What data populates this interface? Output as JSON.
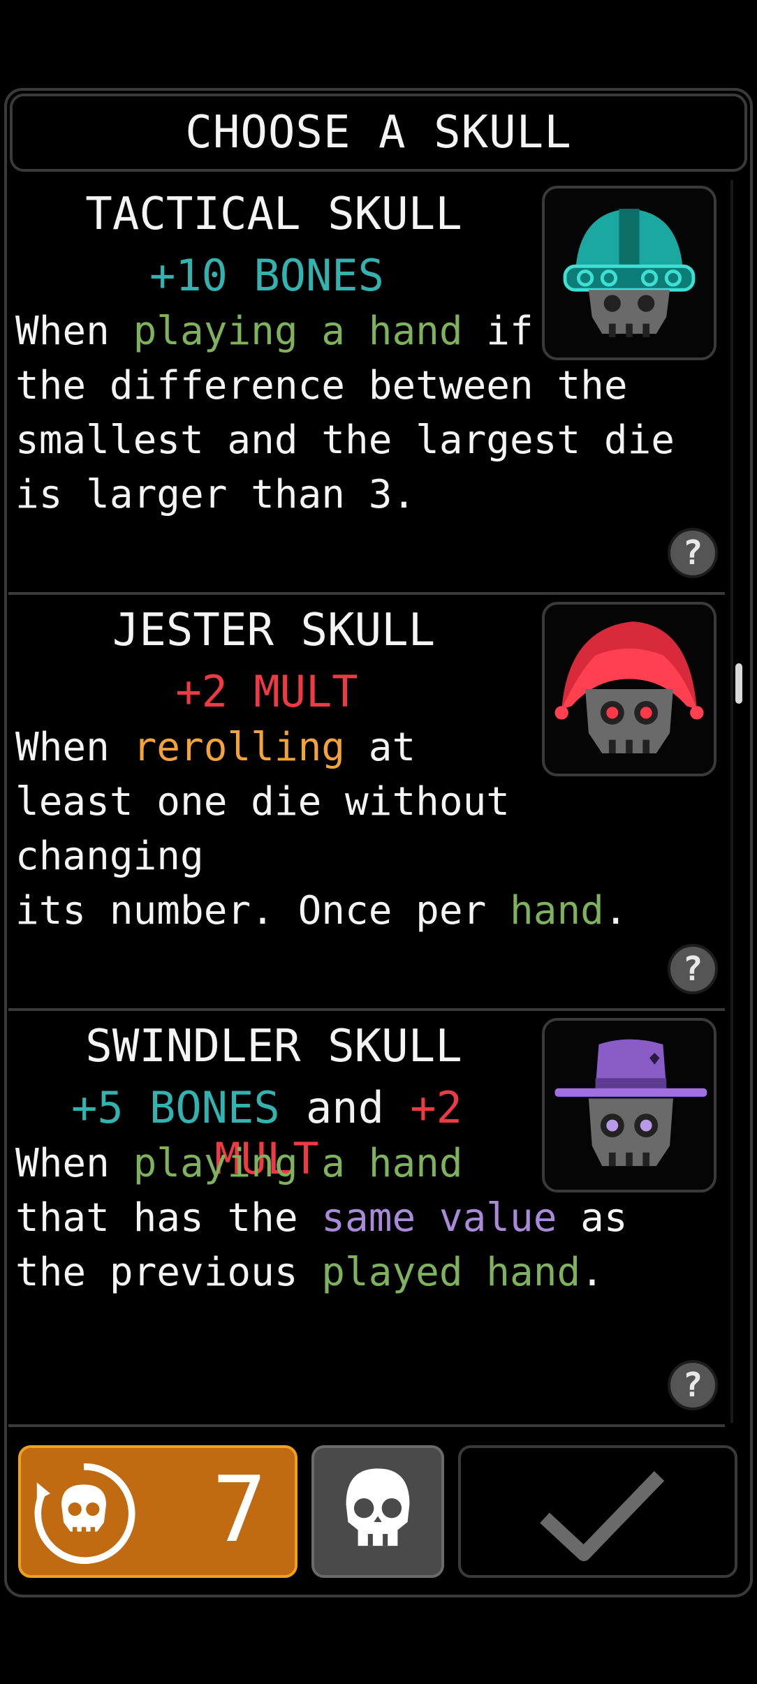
{
  "title": "CHOOSE A SKULL",
  "cards": [
    {
      "name": "TACTICAL SKULL",
      "reward": [
        {
          "text": "+10 BONES",
          "style": "teal"
        }
      ],
      "desc": [
        {
          "text": "When "
        },
        {
          "text": "playing a hand",
          "style": "green"
        },
        {
          "text": " if\nthe difference between the\nsmallest and the largest die\nis larger than 3."
        }
      ],
      "icon": "helmet-skull-icon",
      "help": "?"
    },
    {
      "name": "JESTER SKULL",
      "reward": [
        {
          "text": "+2 MULT",
          "style": "red"
        }
      ],
      "desc": [
        {
          "text": "When "
        },
        {
          "text": "rerolling",
          "style": "orange"
        },
        {
          "text": " at\nleast one die without changing\nits number. Once per "
        },
        {
          "text": "hand",
          "style": "green"
        },
        {
          "text": "."
        }
      ],
      "icon": "jester-skull-icon",
      "help": "?"
    },
    {
      "name": "SWINDLER SKULL",
      "reward": [
        {
          "text": "+5 BONES",
          "style": "teal"
        },
        {
          "text": " and "
        },
        {
          "text": "+2 MULT",
          "style": "red"
        }
      ],
      "desc": [
        {
          "text": "When "
        },
        {
          "text": "playing a hand",
          "style": "green"
        },
        {
          "text": "\nthat has the "
        },
        {
          "text": "same value",
          "style": "purple"
        },
        {
          "text": " as\nthe previous "
        },
        {
          "text": "played hand",
          "style": "green"
        },
        {
          "text": "."
        }
      ],
      "icon": "hat-skull-icon",
      "help": "?"
    }
  ],
  "footer": {
    "reroll_count": "7",
    "reroll_icon": "reroll-skull-icon",
    "skull_icon": "skull-icon",
    "confirm_icon": "checkmark-icon"
  },
  "colors": {
    "teal": "#33b3b0",
    "red": "#ee3a44",
    "green": "#7eb25c",
    "orange": "#f2a33a",
    "purple": "#a98ad8",
    "reroll_bg": "#c06a12"
  }
}
